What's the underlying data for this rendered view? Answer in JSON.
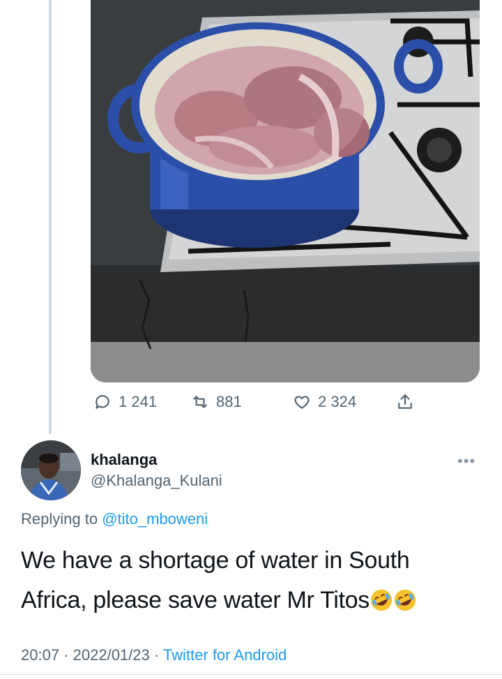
{
  "tweet_media": {
    "alt": ""
  },
  "actions": {
    "replies": "1 241",
    "retweets": "881",
    "likes": "2 324"
  },
  "reply_tweet": {
    "author_name": "khalanga",
    "author_handle": "@Khalanga_Kulani",
    "replying_prefix": "Replying to",
    "replying_to": "@tito_mboweni",
    "text": "We have a shortage of water in South Africa, please save water Mr Titos",
    "emojis": [
      "rolling-on-floor-laughing",
      "rolling-on-floor-laughing"
    ],
    "time": "20:07",
    "separator": "·",
    "date": "2022/01/23",
    "client": "Twitter for Android"
  },
  "colors": {
    "link": "#1d9bf0",
    "secondary_text": "#536471",
    "thread_line": "#cfd9de",
    "pot_blue": "#2b4fa8"
  }
}
